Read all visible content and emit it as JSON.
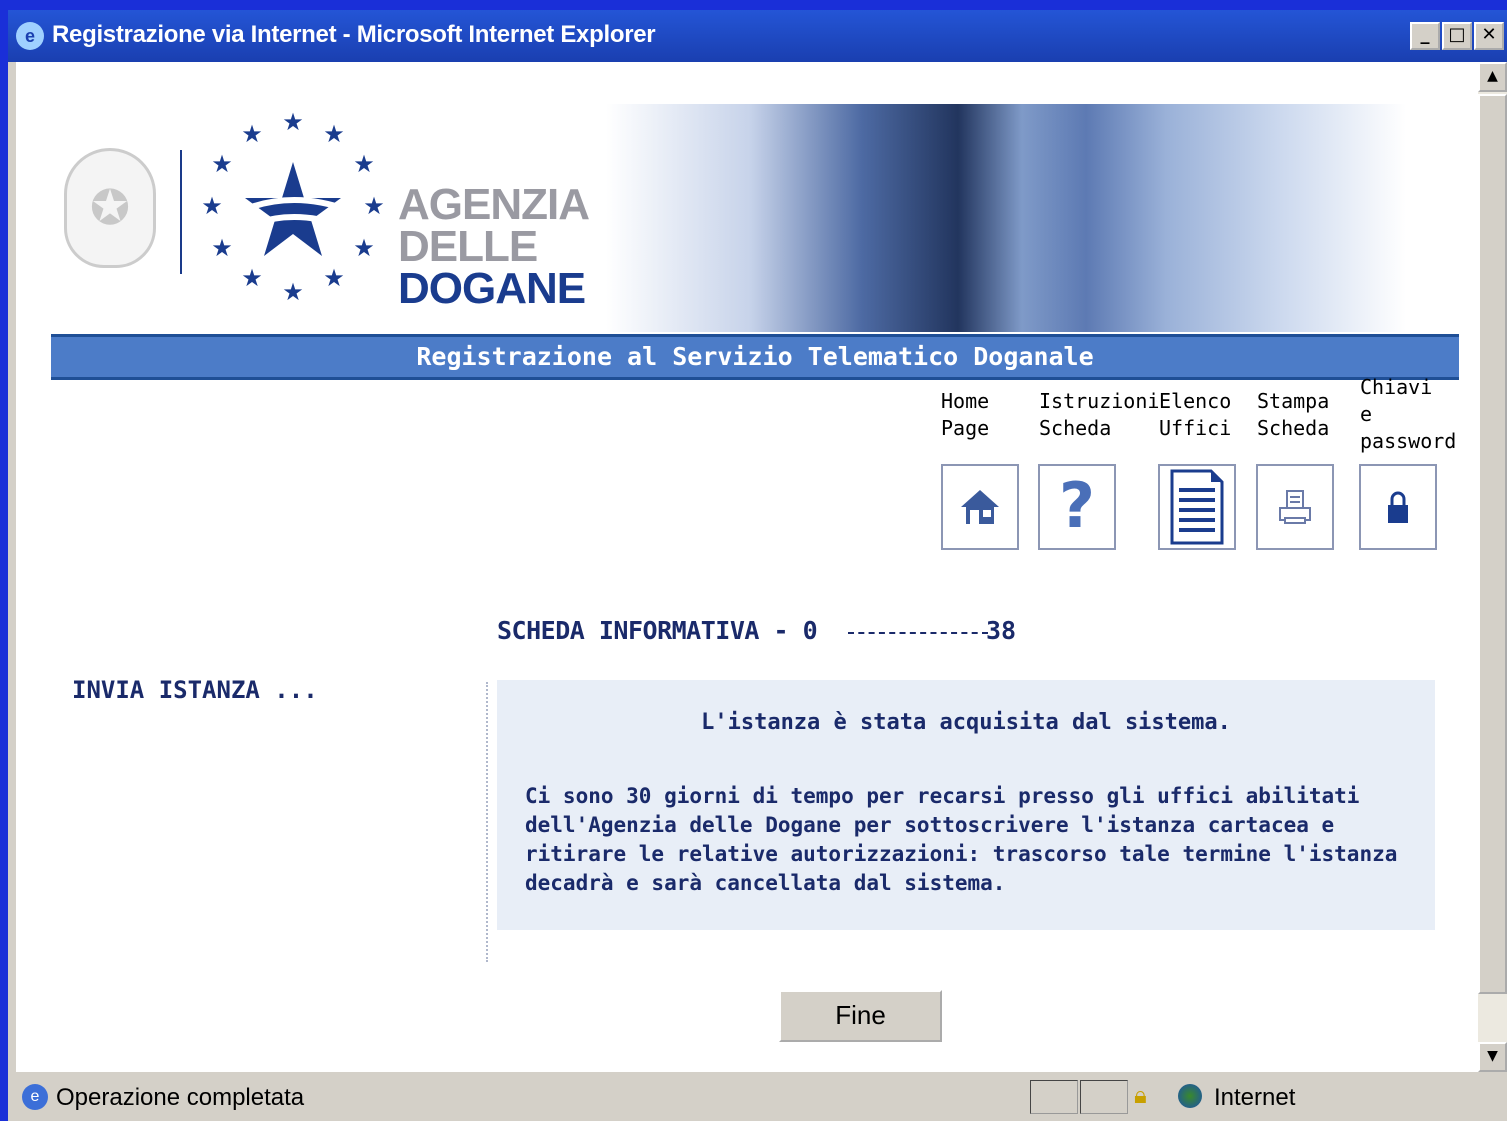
{
  "window": {
    "title": "Registrazione via Internet - Microsoft Internet Explorer",
    "minimize": "_",
    "maximize": "□",
    "close": "✕"
  },
  "header": {
    "agency_line1": "AGENZIA",
    "agency_line2": "DELLE",
    "agency_line3": "DOGANE",
    "banner": "Registrazione al Servizio Telematico Doganale"
  },
  "nav": [
    {
      "label": "Home\nPage",
      "icon": "house-icon"
    },
    {
      "label": "Istruzioni\nScheda",
      "icon": "question-icon"
    },
    {
      "label": "Elenco\nUffici",
      "icon": "document-list-icon"
    },
    {
      "label": "Stampa\nScheda",
      "icon": "printer-icon"
    },
    {
      "label": "Chiavi\ne\npassword",
      "icon": "padlock-icon"
    }
  ],
  "main": {
    "sheet_title_start": "SCHEDA INFORMATIVA - 0",
    "sheet_title_end": "38",
    "side_label": "INVIA ISTANZA ...",
    "message_title": "L'istanza è stata acquisita dal sistema.",
    "message_body": "Ci sono 30 giorni di tempo per recarsi presso gli uffici abilitati dell'Agenzia delle Dogane per sottoscrivere l'istanza cartacea e ritirare le relative autorizzazioni: trascorso tale termine l'istanza decadrà e sarà cancellata dal sistema.",
    "finish_button": "Fine"
  },
  "statusbar": {
    "status_text": "Operazione completata",
    "zone_text": "Internet"
  },
  "colors": {
    "banner": "#4c7cc8",
    "text_navy": "#1a2a6a",
    "message_bg": "#e8eef7",
    "desktop": "#1a2fd8"
  }
}
